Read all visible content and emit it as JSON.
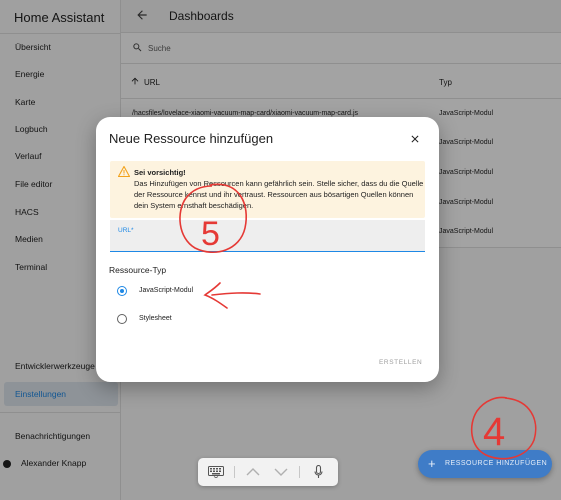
{
  "app": {
    "title": "Home Assistant"
  },
  "sidebar": {
    "items": [
      {
        "label": "Übersicht"
      },
      {
        "label": "Energie"
      },
      {
        "label": "Karte"
      },
      {
        "label": "Logbuch"
      },
      {
        "label": "Verlauf"
      },
      {
        "label": "File editor"
      },
      {
        "label": "HACS"
      },
      {
        "label": "Medien"
      },
      {
        "label": "Terminal"
      }
    ],
    "dev_tools": "Entwicklerwerkzeuge",
    "settings": "Einstellungen",
    "notifications": "Benachrichtigungen",
    "user": "Alexander Knapp"
  },
  "header": {
    "title": "Dashboards"
  },
  "search": {
    "placeholder": "Suche"
  },
  "table": {
    "columns": [
      "URL",
      "Typ"
    ],
    "rows": [
      {
        "url": "/hacsfiles/lovelace-xiaomi-vacuum-map-card/xiaomi-vacuum-map-card.js",
        "type": "JavaScript-Modul"
      },
      {
        "url": "",
        "type": "JavaScript-Modul"
      },
      {
        "url": "",
        "type": "JavaScript-Modul"
      },
      {
        "url": "",
        "type": "JavaScript-Modul"
      },
      {
        "url": "",
        "type": "JavaScript-Modul"
      }
    ]
  },
  "dialog": {
    "title": "Neue Ressource hinzufügen",
    "warning_title": "Sei vorsichtig!",
    "warning_text": "Das Hinzufügen von Ressourcen kann gefährlich sein. Stelle sicher, dass du die Quelle der Ressource kennst und ihr vertraust. Ressourcen aus bösartigen Quellen können dein System ernsthaft beschädigen.",
    "url_label": "URL*",
    "resource_type_label": "Ressource-Typ",
    "options": [
      {
        "label": "JavaScript-Modul",
        "checked": true
      },
      {
        "label": "Stylesheet",
        "checked": false
      }
    ],
    "create_label": "ERSTELLEN"
  },
  "fab": {
    "label": "RESSOURCE HINZUFÜGEN"
  },
  "annotations": {
    "step5": "5",
    "step4": "4"
  },
  "colors": {
    "accent": "#1e88e5",
    "annotation": "#e53935",
    "warning_bg": "#fdf3df"
  }
}
